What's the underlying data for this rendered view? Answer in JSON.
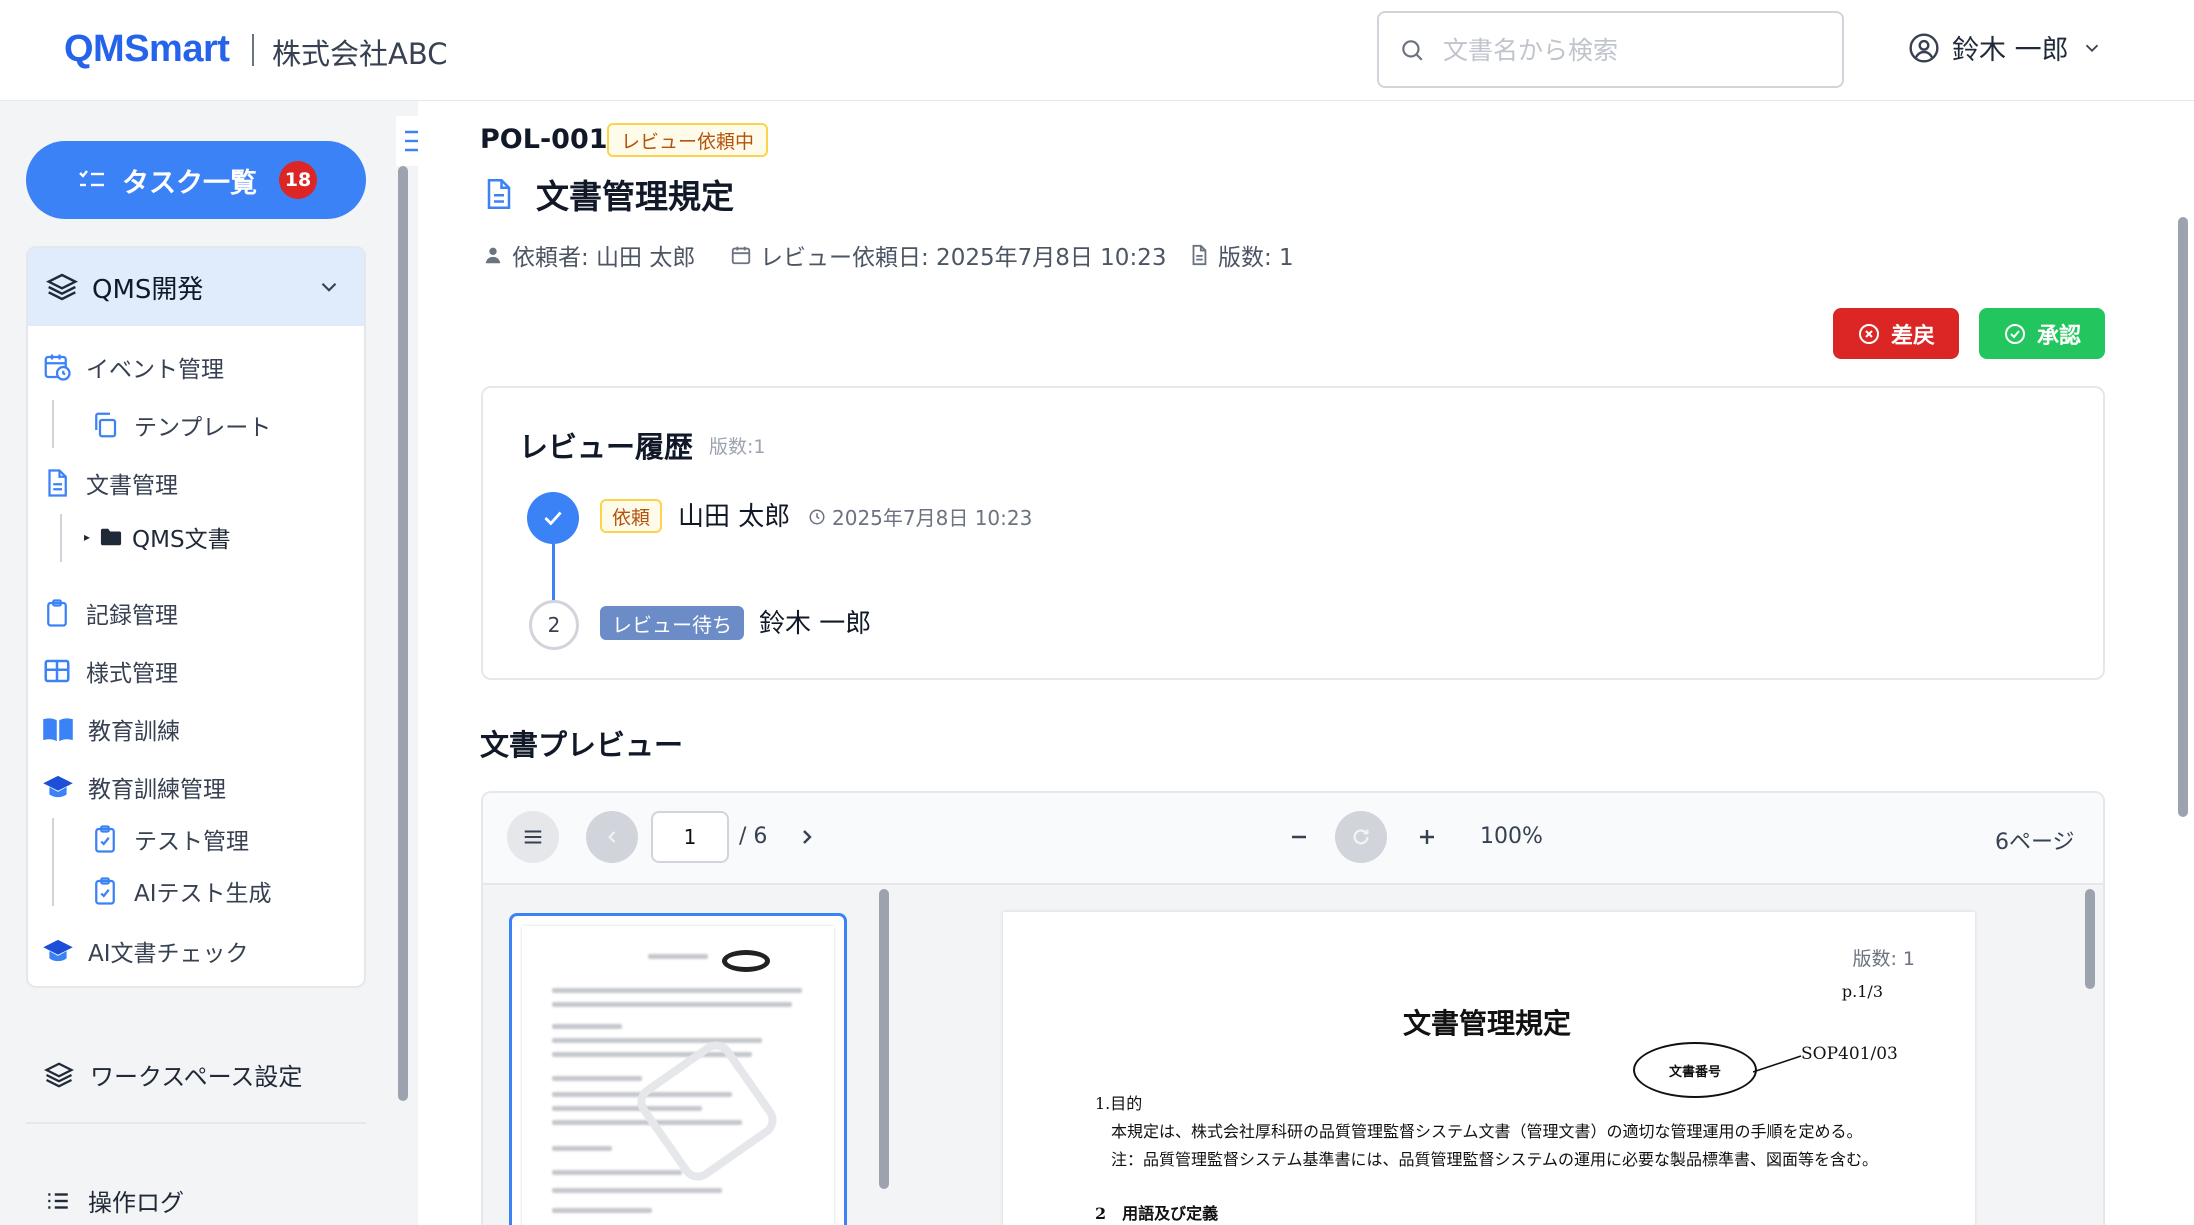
{
  "header": {
    "brand": "QMSmart",
    "company": "株式会社ABC",
    "search_placeholder": "文書名から検索",
    "user_name": "鈴木 一郎"
  },
  "sidebar": {
    "task_button": {
      "label": "タスク一覧",
      "count": "18"
    },
    "section": "QMS開発",
    "items": [
      {
        "label": "イベント管理",
        "icon": "calendar-clock-icon"
      },
      {
        "label": "テンプレート",
        "icon": "copy-icon"
      },
      {
        "label": "文書管理",
        "icon": "document-icon"
      },
      {
        "label": "QMS文書",
        "icon": "folder-icon"
      },
      {
        "label": "記録管理",
        "icon": "clipboard-icon"
      },
      {
        "label": "様式管理",
        "icon": "table-icon"
      },
      {
        "label": "教育訓練",
        "icon": "book-open-icon"
      },
      {
        "label": "教育訓練管理",
        "icon": "graduation-cap-icon"
      },
      {
        "label": "テスト管理",
        "icon": "clipboard-check-icon"
      },
      {
        "label": "AIテスト生成",
        "icon": "clipboard-check-icon"
      },
      {
        "label": "AI文書チェック",
        "icon": "graduation-cap-icon"
      }
    ],
    "workspace_settings": "ワークスペース設定",
    "operation_log": "操作ログ"
  },
  "document": {
    "code": "POL-001",
    "status": "レビュー依頼中",
    "title": "文書管理規定",
    "requester": "依頼者: 山田 太郎",
    "review_date": "レビュー依頼日: 2025年7月8日 10:23",
    "version": "版数: 1"
  },
  "actions": {
    "reject": "差戻",
    "approve": "承認"
  },
  "review_history": {
    "title": "レビュー履歴",
    "version_label": "版数:1",
    "steps": [
      {
        "tag": "依頼",
        "name": "山田 太郎",
        "time": "2025年7月8日 10:23"
      },
      {
        "number": "2",
        "tag": "レビュー待ち",
        "name": "鈴木 一郎"
      }
    ]
  },
  "preview": {
    "title": "文書プレビュー",
    "current_page": "1",
    "total_pages": "/ 6",
    "zoom": "100%",
    "page_count": "6ページ",
    "page": {
      "version": "版数: 1",
      "page_no": "p.1/3",
      "title": "文書管理規定",
      "callout": "文書番号",
      "doc_number": "SOP401/03",
      "section1": "1.目的",
      "line1": "本規定は、株式会社厚科研の品質管理監督システム文書（管理文書）の適切な管理運用の手順を定める。",
      "line2": "注：品質管理監督システム基準書には、品質管理監督システムの運用に必要な製品標準書、図面等を含む。",
      "section2": "2　用語及び定義"
    }
  },
  "colors": {
    "brand": "#2563eb",
    "primary": "#3b82f6",
    "danger": "#dc2626",
    "success": "#22c55e",
    "warning_bg": "#fffbeb",
    "warning_text": "#b45309"
  }
}
